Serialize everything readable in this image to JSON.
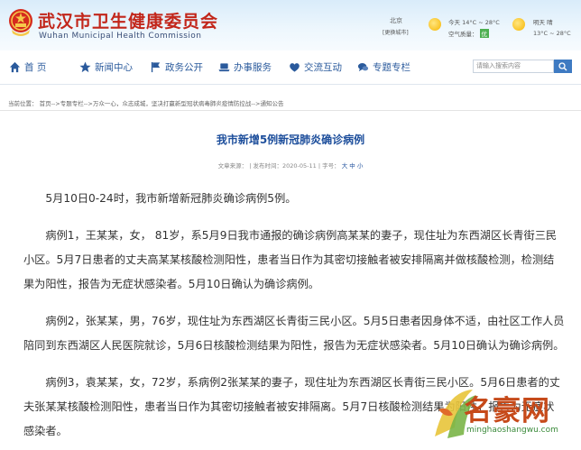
{
  "header": {
    "site_title": "武汉市卫生健康委员会",
    "site_subtitle": "Wuhan Municipal Health Commission",
    "emblem_icon": "national-emblem-icon"
  },
  "weather": {
    "city": "北京",
    "change_city": "[更换城市]",
    "today": "今天 14°C ~ 28°C",
    "air_label": "空气质量：",
    "air_value": "优",
    "tomorrow": "明天 晴",
    "tomorrow_temp": "13°C ~ 28°C"
  },
  "nav": {
    "items": [
      {
        "label": "首 页",
        "icon": "home-icon"
      },
      {
        "label": "新闻中心",
        "icon": "star-icon"
      },
      {
        "label": "政务公开",
        "icon": "flag-icon"
      },
      {
        "label": "办事服务",
        "icon": "laptop-icon"
      },
      {
        "label": "交流互动",
        "icon": "heart-icon"
      },
      {
        "label": "专题专栏",
        "icon": "chat-icon"
      }
    ],
    "search_placeholder": "请输入搜索内容"
  },
  "breadcrumb": "当前位置：  首页-->专题专栏-->万众一心，众志成城，坚决打赢新型冠状病毒肺炎疫情防控战-->通知公告",
  "article": {
    "title": "我市新增5例新冠肺炎确诊病例",
    "meta_source": "文章来源：",
    "meta_date": "| 发布时间：2020-05-11 |",
    "meta_fontsize_label": "字号：",
    "meta_fontsize_options": "大 中 小",
    "paragraphs": [
      "5月10日0-24时，我市新增新冠肺炎确诊病例5例。",
      "病例1，王某某，女， 81岁，系5月9日我市通报的确诊病例高某某的妻子，现住址为东西湖区长青街三民小区。5月7日患者的丈夫高某某核酸检测阳性，患者当日作为其密切接触者被安排隔离并做核酸检测，检测结果为阳性，报告为无症状感染者。5月10日确认为确诊病例。",
      "病例2，张某某，男，76岁，现住址为东西湖区长青街三民小区。5月5日患者因身体不适，由社区工作人员陪同到东西湖区人民医院就诊，5月6日核酸检测结果为阳性，报告为无症状感染者。5月10日确认为确诊病例。",
      "病例3，袁某某，女，72岁，系病例2张某某的妻子，现住址为东西湖区长青街三民小区。5月6日患者的丈夫张某某核酸检测阳性，患者当日作为其密切接触者被安排隔离。5月7日核酸检测结果为阳性，报告为无症状感染者。"
    ]
  },
  "watermark": {
    "text": "名豪网",
    "url": "minghaoshangwu.com"
  },
  "colors": {
    "title_red": "#c2261a",
    "nav_blue": "#2a5a9c",
    "article_title": "#1e4f9c"
  }
}
